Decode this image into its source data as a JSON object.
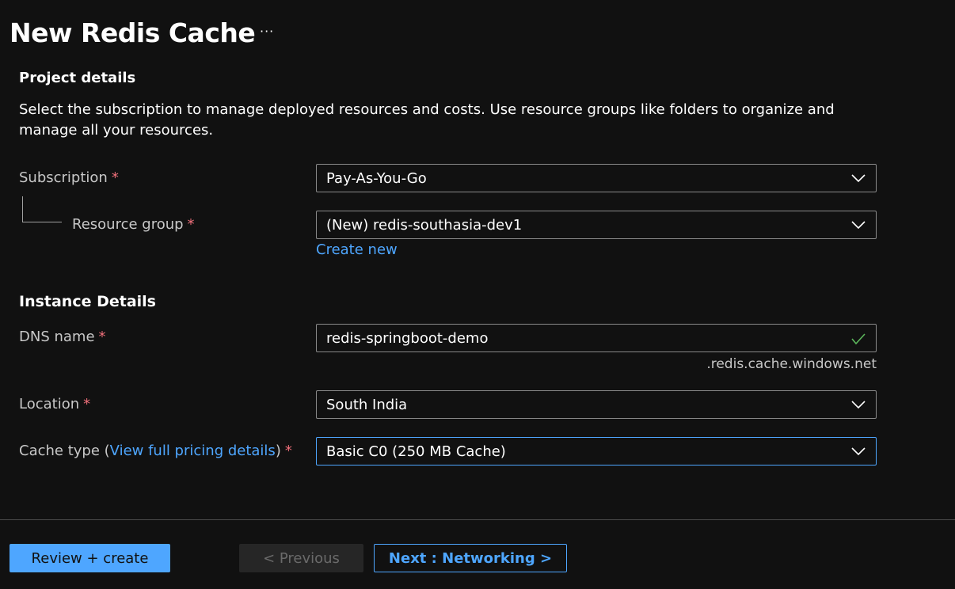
{
  "header": {
    "title": "New Redis Cache",
    "more_label": "···"
  },
  "project_details": {
    "heading": "Project details",
    "description": "Select the subscription to manage deployed resources and costs. Use resource groups like folders to organize and manage all your resources.",
    "subscription": {
      "label": "Subscription",
      "required": "*",
      "value": "Pay-As-You-Go"
    },
    "resource_group": {
      "label": "Resource group",
      "required": "*",
      "value": "(New) redis-southasia-dev1",
      "create_new": "Create new"
    }
  },
  "instance_details": {
    "heading": "Instance Details",
    "dns_name": {
      "label": "DNS name",
      "required": "*",
      "value": "redis-springboot-demo",
      "suffix": ".redis.cache.windows.net"
    },
    "location": {
      "label": "Location",
      "required": "*",
      "value": "South India"
    },
    "cache_type": {
      "label_prefix": "Cache type (",
      "link": "View full pricing details",
      "label_suffix": ")",
      "required": "*",
      "value": "Basic C0 (250 MB Cache)"
    }
  },
  "footer": {
    "review_create": "Review + create",
    "previous": "< Previous",
    "next": "Next : Networking >"
  },
  "colors": {
    "background": "#111111",
    "accent": "#4ea6ff",
    "required": "#f1707b",
    "valid": "#5bb55b"
  },
  "icons": {
    "dropdown": "chevron-down-icon",
    "valid": "checkmark-icon",
    "more": "ellipsis-icon"
  }
}
